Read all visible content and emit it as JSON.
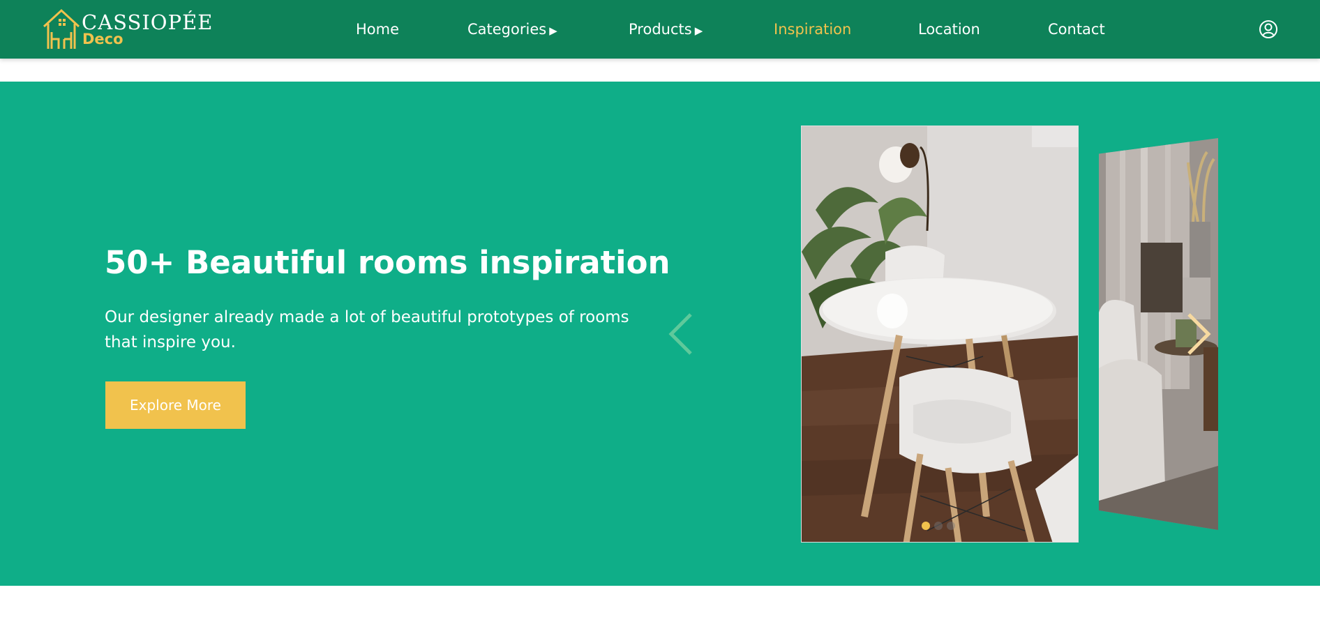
{
  "brand": {
    "name": "CASSIOPÉE",
    "sub": "Deco"
  },
  "nav": {
    "home": "Home",
    "categories": "Categories",
    "products": "Products",
    "inspiration": "Inspiration",
    "location": "Location",
    "contact": "Contact",
    "submenu_indicator": "▶",
    "active": "inspiration"
  },
  "hero": {
    "title": "50+ Beautiful rooms inspiration",
    "description": "Our designer already made a lot of beautiful prototypes of rooms that inspire you.",
    "button_label": "Explore More"
  },
  "carousel": {
    "active_index": 1,
    "dot_count": 3,
    "prev_icon": "chevron-left-icon",
    "next_icon": "chevron-right-icon"
  },
  "colors": {
    "header_bg": "#0e8259",
    "hero_bg": "#0fae88",
    "accent": "#f1c24d",
    "text_light": "#ffffff"
  }
}
